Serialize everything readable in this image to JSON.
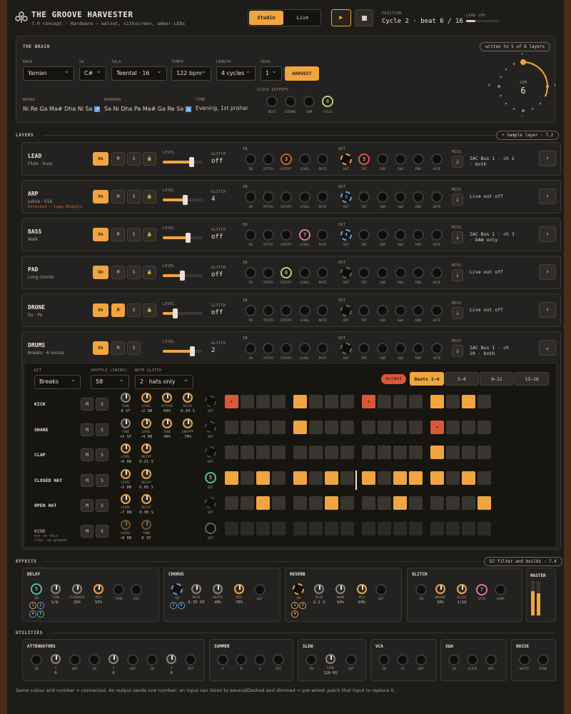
{
  "header": {
    "title": "THE GROOVE HARVESTER",
    "subtitle": "7.0 concept · Hardware — walnut, silkscreen, amber LEDs",
    "mode_studio": "Studio",
    "mode_live": "Live",
    "position_label": "POSITION",
    "position": "Cycle 2 · beat 6 / 16",
    "load_label": "LOAD 28%",
    "load": 0.28
  },
  "brain": {
    "title": "THE BRAIN",
    "note": "writes to 5 of 6 layers",
    "raga_label": "RAGA",
    "raga": "Yaman",
    "sa_label": "SA",
    "sa": "C#",
    "tala_label": "TALA",
    "tala": "Teental · 16",
    "tempo_label": "TEMPO",
    "tempo": "122 bpm",
    "length_label": "LENGTH",
    "length": "4 cycles",
    "seed_label": "SEED",
    "seed": "1",
    "harvest": "HARVEST",
    "aroha_label": "AROHA",
    "aroha": "Ni Re Ga Ma# Dha Ni Ṡa",
    "avaroha_label": "AVAROHA",
    "avaroha": "Ṡa Ni Dha Pa Ma# Ga Re Sa",
    "time_label": "TIME",
    "time": "Evening, 1st prahar",
    "clock_label": "CLOCK OUTPUTS",
    "clock": [
      "BEAT",
      "VIBHAG",
      "SAM",
      "CYCLE"
    ],
    "clock_num": "8",
    "sam_label": "SAM",
    "sam_value": "6",
    "dial_plus": "+",
    "dial_0": "0",
    "dial_1": "1",
    "dial_minus": "−"
  },
  "layers_title": "LAYERS",
  "sample_layer": "+ Sample layer · 7.2",
  "jacks_in": [
    "IN",
    "PITCH",
    "CUTOFF",
    "LEVEL",
    "RATE"
  ],
  "jacks_out": [
    "OUT",
    "TRI",
    "SQR",
    "S&H",
    "ENV",
    "GATE"
  ],
  "in_label": "IN",
  "out_label": "OUT",
  "level_label": "LEVEL",
  "glitch_label": "GLITCH",
  "midi_label": "MIDI",
  "layers": [
    {
      "name": "LEAD",
      "sub": "Flute · busy",
      "glitch": "off",
      "midi": "IAC Bus 1 · ch 1 · both",
      "n1": "3",
      "n2": "3"
    },
    {
      "name": "ARP",
      "sub": "Lehra · V16",
      "warn": "Detached — raga Bhupali",
      "glitch": "4",
      "midi": "Live out off",
      "n2": "2"
    },
    {
      "name": "BASS",
      "sub": "Walk",
      "glitch": "off",
      "midi": "IAC Bus 1 · ch 3 · DAW only",
      "n1": "7",
      "n2": "4"
    },
    {
      "name": "PAD",
      "sub": "Long chords",
      "glitch": "off",
      "midi": "Live out off",
      "n1": "8"
    },
    {
      "name": "DRONE",
      "sub": "Sa · Pa",
      "glitch": "off",
      "midi": "Live out off"
    },
    {
      "name": "DRUMS",
      "sub": "Breaks · 6 voices",
      "glitch": "2",
      "midi": "IAC Bus 1 · ch 10 · both"
    }
  ],
  "btn": {
    "on": "On",
    "m": "M",
    "s": "S"
  },
  "drums": {
    "kit_label": "KIT",
    "kit": "Breaks",
    "shuffle_label": "SHUFFLE (SWING)",
    "shuffle": "58",
    "glitch_label": "NOTE GLITCH",
    "glitch": "2 · hats only",
    "accent": "accent",
    "pages": [
      "Beats 1–4",
      "5–8",
      "9–12",
      "13–16"
    ],
    "voices": [
      {
        "name": "KICK",
        "knobs": [
          [
            "TONE",
            "0 st"
          ],
          [
            "LEVEL",
            "−2 dB"
          ],
          [
            "ATTACK",
            "60%"
          ],
          [
            "DECAY",
            "0.34 s"
          ]
        ],
        "steps": "r000a000r000a0a0"
      },
      {
        "name": "SNARE",
        "knobs": [
          [
            "TONE",
            "+1 st"
          ],
          [
            "LEVEL",
            "−4 dB"
          ],
          [
            "TONE",
            "40%"
          ],
          [
            "SNAPPY",
            "70%"
          ]
        ],
        "steps": "0000a0000000r000"
      },
      {
        "name": "CLAP",
        "knobs": [
          [
            "LEVEL",
            "−6 dB"
          ],
          [
            "DECAY",
            "0.21 s"
          ]
        ],
        "steps": "000000000000a000"
      },
      {
        "name": "CLOSED HAT",
        "knobs": [
          [
            "LEVEL",
            "−5 dB"
          ],
          [
            "DECAY",
            "0.05 s"
          ]
        ],
        "steps": "a0a0a0a0a0aaa0a0",
        "num": "5"
      },
      {
        "name": "OPEN HAT",
        "knobs": [
          [
            "LEVEL",
            "−7 dB"
          ],
          [
            "DECAY",
            "0.30 s"
          ]
        ],
        "steps": "00a000a000a0000a"
      },
      {
        "name": "RIDE",
        "note": "not in this clip, so greyed",
        "knobs": [
          [
            "LEVEL",
            "−8 dB"
          ],
          [
            "TONE",
            "0 st"
          ]
        ],
        "steps": "dddddddddddddddd"
      }
    ]
  },
  "effects": {
    "title": "EFFECTS",
    "note": "DJ filter and builds · 7.4",
    "delay": {
      "name": "DELAY",
      "knobs": [
        [
          "TIME",
          "1/8."
        ],
        [
          "FEEDBACK",
          "35%"
        ],
        [
          "MIX",
          "55%"
        ]
      ],
      "jacks": [
        "TIME",
        "OUT"
      ],
      "in": "IN",
      "n": "5",
      "taps": [
        "1",
        "2",
        "4",
        "5"
      ]
    },
    "chorus": {
      "name": "CHORUS",
      "knobs": [
        [
          "RATE",
          "0.35 Hz"
        ],
        [
          "DEPTH",
          "40%"
        ],
        [
          "MIX",
          "70%"
        ]
      ],
      "in": "IN",
      "out": "OUT",
      "taps": [
        "2",
        "6"
      ]
    },
    "reverb": {
      "name": "REVERB",
      "knobs": [
        [
          "SIZE",
          "2.2 s"
        ],
        [
          "DAMP",
          "50%"
        ],
        [
          "MIX",
          "60%"
        ]
      ],
      "in": "IN",
      "out": "OUT",
      "taps": [
        "1",
        "3",
        "4"
      ]
    },
    "glitch": {
      "name": "GLITCH",
      "knobs": [
        [
          "AMOUNT",
          "30%"
        ],
        [
          "SLICE",
          "1/16"
        ]
      ],
      "in": "IN",
      "gate": "GATE",
      "jump": "JUMP",
      "n": "7"
    },
    "master": "MASTER"
  },
  "utilities": {
    "title": "UTILITIES",
    "att": {
      "name": "ATTENUATORS",
      "labels": [
        "IN",
        "1",
        "OUT",
        "IN",
        "1",
        "OUT",
        "IN",
        "1",
        "OUT"
      ],
      "vals": [
        "0",
        "0",
        "0"
      ]
    },
    "summer": {
      "name": "SUMMER",
      "labels": [
        "A",
        "B",
        "C",
        "OUT"
      ]
    },
    "slew": {
      "name": "SLEW",
      "labels": [
        "IN",
        "TIME",
        "OUT"
      ],
      "time": "120 ms"
    },
    "vca": {
      "name": "VCA",
      "labels": [
        "IN",
        "CV",
        "OUT"
      ]
    },
    "sh": {
      "name": "S&H",
      "labels": [
        "IN",
        "CLOCK",
        "OUT"
      ]
    },
    "noise": {
      "name": "NOISE",
      "labels": [
        "WHITE",
        "PINK"
      ]
    }
  },
  "footer": {
    "left": "Same colour and number = connected. An output sends one number; an input can listen to several.",
    "right": "Dashed and dimmed = pre-wired: patch that input to replace it."
  },
  "colors": {
    "accent": "#f0a540",
    "red": "#d9573b",
    "teal": "#4fc2a8",
    "pink": "#e07a9a",
    "lime": "#b8d86a",
    "blue": "#6aa0e0"
  }
}
